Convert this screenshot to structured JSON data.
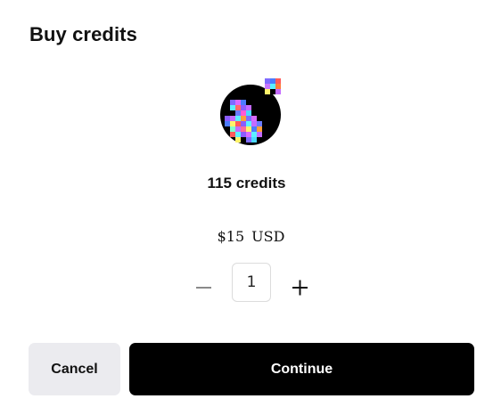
{
  "dialog": {
    "title": "Buy credits"
  },
  "product": {
    "icon": "pixel-art-credits-icon",
    "credits_label": "115 credits",
    "price_amount": "$15",
    "price_currency": "USD"
  },
  "quantity": {
    "value": "1",
    "decrement_icon": "minus-icon",
    "increment_icon": "plus-icon"
  },
  "actions": {
    "cancel_label": "Cancel",
    "continue_label": "Continue"
  },
  "colors": {
    "primary": "#000000",
    "secondary_bg": "#ebebef",
    "text": "#111111"
  }
}
